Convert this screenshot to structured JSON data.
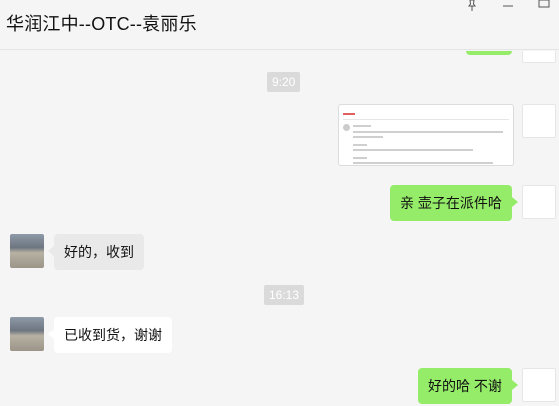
{
  "header": {
    "title": "华润江中--OTC--袁丽乐"
  },
  "window_controls": {
    "pin": "pin-icon",
    "minimize": "minimize-icon",
    "maximize": "maximize-icon"
  },
  "messages": {
    "time_1": "9:20",
    "sent_shipping": "亲 壶子在派件哈",
    "received_ok": "好的，收到",
    "time_2": "16:13",
    "received_goods": "已收到货，谢谢",
    "sent_welcome": "好的哈 不谢"
  },
  "colors": {
    "sent_bubble": "#95ec69",
    "received_bubble": "#ffffff",
    "background": "#f5f5f5",
    "timestamp_bg": "#dadada"
  }
}
